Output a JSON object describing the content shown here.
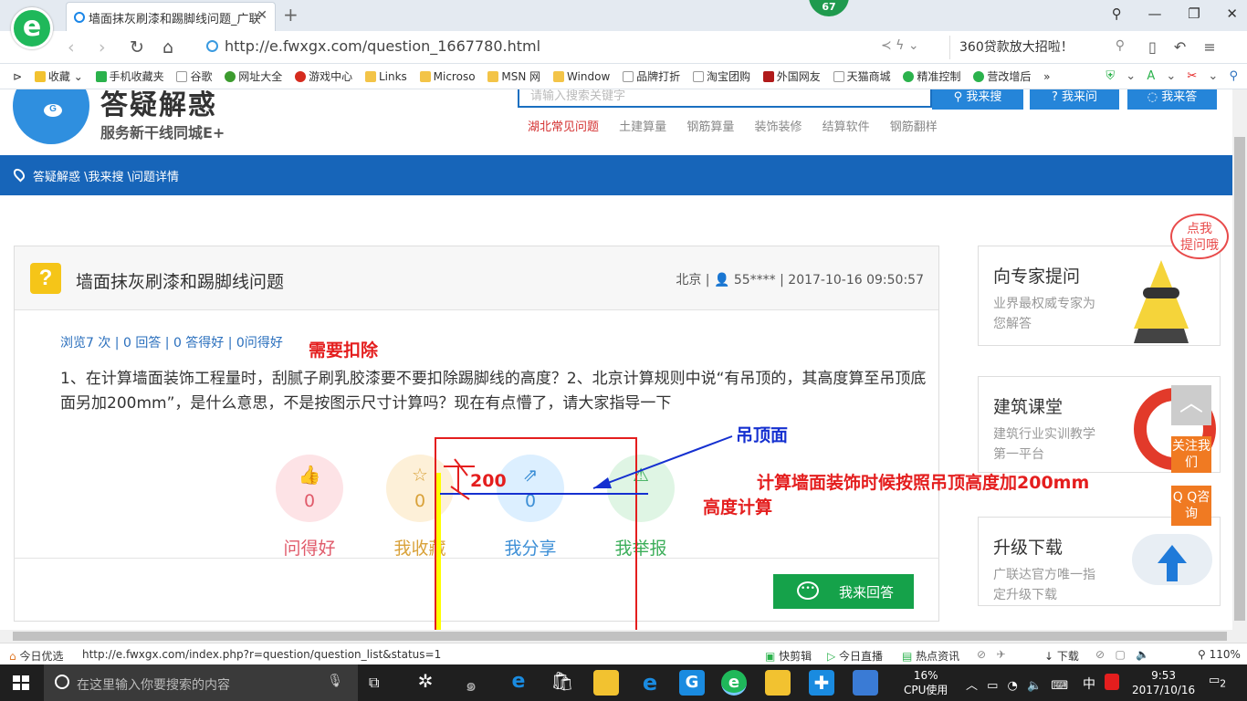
{
  "browser": {
    "tab_title": "墙面抹灰刷漆和踢脚线问题_广联",
    "badge": "67",
    "url": "http://e.fwxgx.com/question_1667780.html",
    "search_text": "360贷款放大招啦！",
    "bookmarks": [
      "收藏",
      "手机收藏夹",
      "谷歌",
      "网址大全",
      "游戏中心",
      "Links",
      "Microso",
      "MSN 网",
      "Window",
      "品牌打折",
      "淘宝团购",
      "外国网友",
      "天猫商城",
      "精准控制",
      "营改增后"
    ],
    "bookmark_more": "»"
  },
  "site": {
    "title": "答疑解惑",
    "subtitle": "服务新干线同城E+",
    "search_placeholder": "请输入搜索关键字",
    "btn_search": "我来搜",
    "btn_ask": "我来问",
    "btn_answer": "我来答",
    "hot_links": [
      "湖北常见问题",
      "土建算量",
      "钢筋算量",
      "装饰装修",
      "结算软件",
      "钢筋翻样"
    ],
    "breadcrumb": "答疑解惑 \\我来搜 \\问题详情"
  },
  "question": {
    "title": "墙面抹灰刷漆和踢脚线问题",
    "meta_location": "北京",
    "meta_user": "55****",
    "meta_time": "2017-10-16 09:50:57",
    "stats": "浏览7 次 | 0 回答 | 0 答得好 | 0问得好",
    "body": "1、在计算墙面装饰工程量时，刮腻子刷乳胶漆要不要扣除踢脚线的高度？2、北京计算规则中说“有吊顶的，其高度算至吊顶底面另加200mm”，是什么意思，不是按图示尺寸计算吗？现在有点懵了，请大家指导一下",
    "actions": [
      {
        "label": "问得好",
        "count": "0",
        "icon": "thumb-icon"
      },
      {
        "label": "我收藏",
        "count": "0",
        "icon": "star-icon"
      },
      {
        "label": "我分享",
        "count": "0",
        "icon": "share-icon"
      },
      {
        "label": "我举报",
        "count": "",
        "icon": "warning-icon"
      }
    ],
    "answer_btn": "我来回答"
  },
  "sidebar": {
    "bubble": "点我\n提问哦",
    "expert_title": "向专家提问",
    "expert_desc": "业界最权威专家为您解答",
    "course_title": "建筑课堂",
    "course_desc": "建筑行业实训教学第一平台",
    "download_title": "升级下载",
    "download_desc": "广联达官方唯一指定升级下载",
    "follow": "关注我们",
    "qq": "Q Q咨询"
  },
  "annotations": {
    "deduct": "需要扣除",
    "ceiling": "吊顶面",
    "plus200": "200",
    "calc_line1": "计算墙面装饰时候按照吊顶高度加200mm",
    "calc_line2": "高度计算"
  },
  "status": {
    "left": "今日优选",
    "url": "http://e.fwxgx.com/index.php?r=question/question_list&status=1",
    "items": [
      "快剪辑",
      "今日直播",
      "热点资讯",
      "下载"
    ],
    "zoom": "110%"
  },
  "taskbar": {
    "search_placeholder": "在这里输入你要搜索的内容",
    "cpu": "16%",
    "cpu_label": "CPU使用",
    "ime": "中",
    "time": "9:53",
    "date": "2017/10/16",
    "notif": "2"
  },
  "colors": {
    "brand_blue": "#1765b9",
    "green": "#15a24a",
    "annotation_red": "#e41e1e",
    "annotation_blue": "#1530d0",
    "highlight_yellow": "#ffff00"
  }
}
